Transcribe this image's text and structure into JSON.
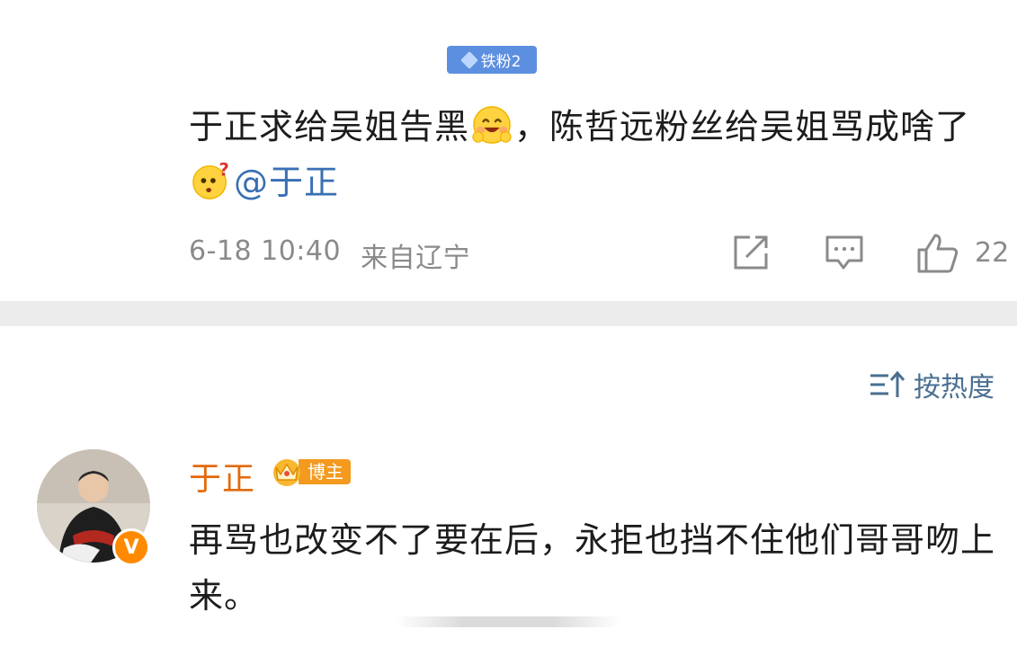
{
  "post": {
    "fan_badge": "铁粉2",
    "text_part1": "于正求给吴姐告黑",
    "emoji1": "grinning-blush-emoji",
    "text_part2": "，陈哲远粉丝给吴姐骂成啥了",
    "emoji2": "confused-question-emoji",
    "mention": "@于正",
    "date": "6-18 10:40",
    "location": "来自辽宁",
    "like_count": "22"
  },
  "sort": {
    "label": "按热度"
  },
  "comment": {
    "username": "于正",
    "badge": "博主",
    "text": "再骂也改变不了要在后，永拒也挡不住他们哥哥吻上来。"
  },
  "colors": {
    "badge_blue": "#5d8fe0",
    "mention_blue": "#3a6fb3",
    "name_orange": "#e36a0c",
    "sort_blue": "#4a6f92",
    "meta_gray": "#8a8a8a"
  }
}
